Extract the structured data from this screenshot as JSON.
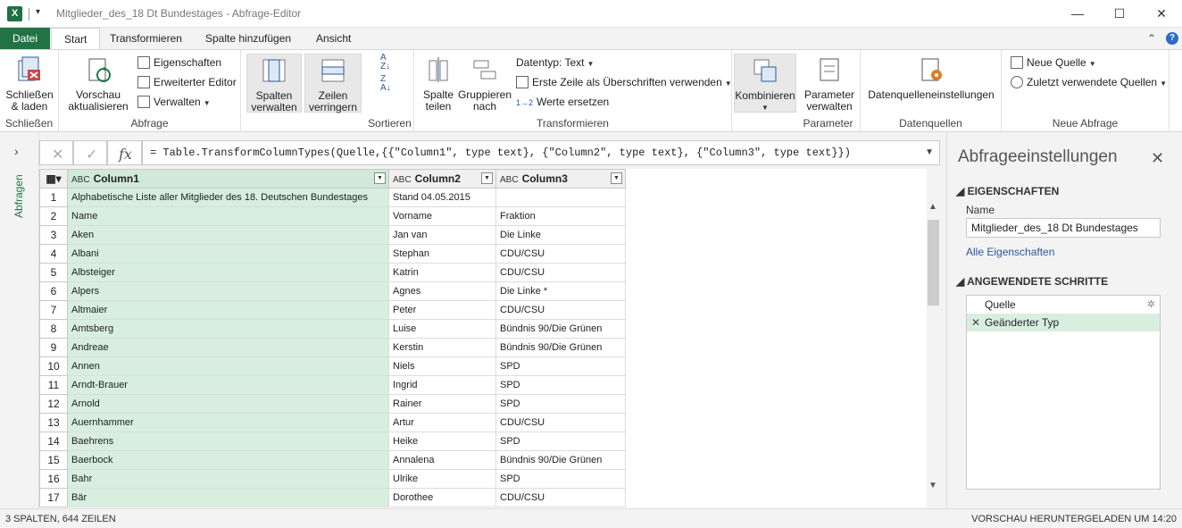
{
  "titlebar": {
    "app_icon": "X",
    "title": "Mitglieder_des_18 Dt Bundestages - Abfrage-Editor"
  },
  "tabs": [
    "Datei",
    "Start",
    "Transformieren",
    "Spalte hinzufügen",
    "Ansicht"
  ],
  "ribbon": {
    "schliessen": {
      "btn": "Schließen\n& laden",
      "group": "Schließen"
    },
    "abfrage": {
      "vorschau": "Vorschau\naktualisieren",
      "eigenschaften": "Eigenschaften",
      "editor": "Erweiterter Editor",
      "verwalten": "Verwalten",
      "group": "Abfrage"
    },
    "spalten": {
      "btn": "Spalten\nverwalten"
    },
    "zeilen": {
      "btn": "Zeilen\nverringern"
    },
    "sortieren": {
      "group": "Sortieren"
    },
    "transform": {
      "teilen": "Spalte\nteilen",
      "gruppieren": "Gruppieren\nnach",
      "datentyp": "Datentyp: Text",
      "erste_zeile": "Erste Zeile als Überschriften verwenden",
      "werte": "Werte ersetzen",
      "group": "Transformieren"
    },
    "kombinieren": {
      "btn": "Kombinieren"
    },
    "parameter": {
      "btn": "Parameter\nverwalten",
      "group": "Parameter"
    },
    "datenquellen": {
      "btn": "Datenquelleneinstellungen",
      "group": "Datenquellen"
    },
    "neue": {
      "quelle": "Neue Quelle",
      "zuletzt": "Zuletzt verwendete Quellen",
      "group": "Neue Abfrage"
    }
  },
  "leftpane": {
    "label": "Abfragen"
  },
  "formula": "= Table.TransformColumnTypes(Quelle,{{\"Column1\", type text}, {\"Column2\", type text}, {\"Column3\", type text}})",
  "table": {
    "type_icon": "ABC",
    "headers": [
      "Column1",
      "Column2",
      "Column3"
    ],
    "rows": [
      [
        "1",
        "Alphabetische Liste aller Mitglieder des 18. Deutschen Bundestages",
        "Stand 04.05.2015",
        ""
      ],
      [
        "2",
        "Name",
        "Vorname",
        "Fraktion"
      ],
      [
        "3",
        "Aken",
        "Jan van",
        "Die Linke"
      ],
      [
        "4",
        "Albani",
        "Stephan",
        "CDU/CSU"
      ],
      [
        "5",
        "Albsteiger",
        "Katrin",
        "CDU/CSU"
      ],
      [
        "6",
        "Alpers",
        "Agnes",
        "Die Linke *"
      ],
      [
        "7",
        "Altmaier",
        "Peter",
        "CDU/CSU"
      ],
      [
        "8",
        "Amtsberg",
        "Luise",
        "Bündnis 90/Die Grünen"
      ],
      [
        "9",
        "Andreae",
        "Kerstin",
        "Bündnis 90/Die Grünen"
      ],
      [
        "10",
        "Annen",
        "Niels",
        "SPD"
      ],
      [
        "11",
        "Arndt-Brauer",
        "Ingrid",
        "SPD"
      ],
      [
        "12",
        "Arnold",
        "Rainer",
        "SPD"
      ],
      [
        "13",
        "Auernhammer",
        "Artur",
        "CDU/CSU"
      ],
      [
        "14",
        "Baehrens",
        "Heike",
        "SPD"
      ],
      [
        "15",
        "Baerbock",
        "Annalena",
        "Bündnis 90/Die Grünen"
      ],
      [
        "16",
        "Bahr",
        "Ulrike",
        "SPD"
      ],
      [
        "17",
        "Bär",
        "Dorothee",
        "CDU/CSU"
      ]
    ]
  },
  "rightpane": {
    "title": "Abfrageeinstellungen",
    "props_header": "EIGENSCHAFTEN",
    "name_label": "Name",
    "name_value": "Mitglieder_des_18 Dt Bundestages",
    "all_props": "Alle Eigenschaften",
    "steps_header": "ANGEWENDETE SCHRITTE",
    "steps": [
      "Quelle",
      "Geänderter Typ"
    ]
  },
  "status": {
    "left": "3 SPALTEN, 644 ZEILEN",
    "right": "VORSCHAU HERUNTERGELADEN UM 14:20"
  },
  "colors": {
    "accent": "#217346",
    "selected": "#d8efe0"
  }
}
